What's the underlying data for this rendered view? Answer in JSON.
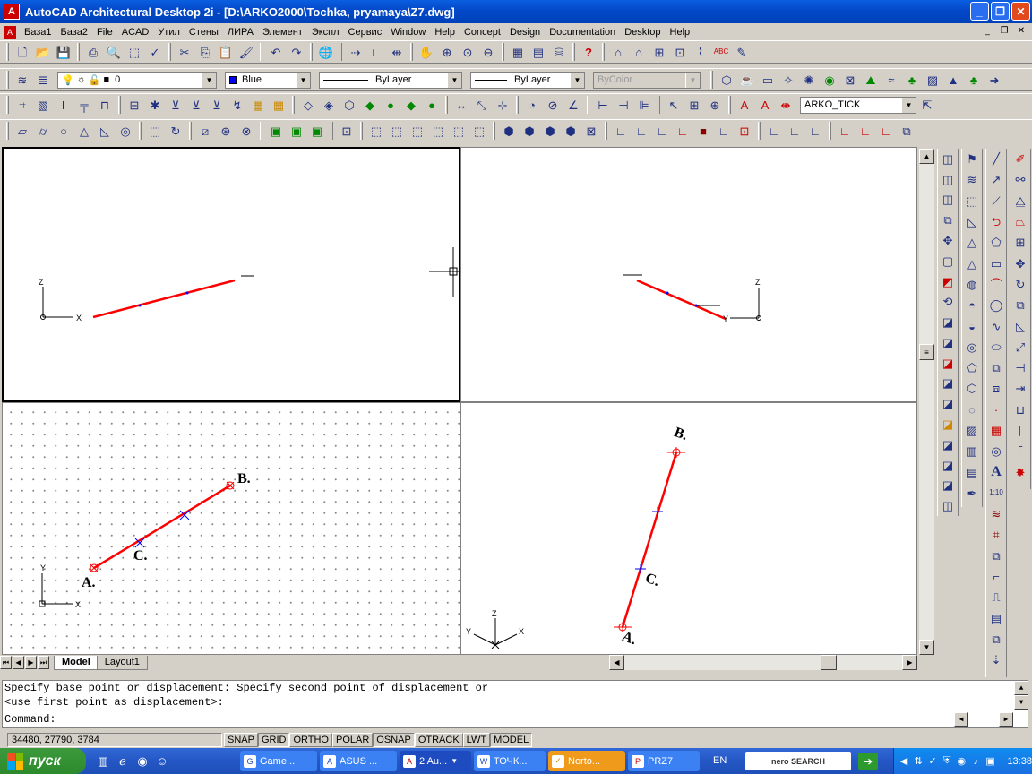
{
  "window": {
    "title": "AutoCAD Architectural Desktop 2i - [D:\\ARKO2000\\Tochka, pryamaya\\Z7.dwg]",
    "app_icon": "autocad-icon",
    "buttons": {
      "minimize": "_",
      "maximize": "❐",
      "close": "✕"
    }
  },
  "menu": {
    "items": [
      "База1",
      "База2",
      "File",
      "ACAD",
      "Утил",
      "Стены",
      "ЛИРА",
      "Элемент",
      "Экспл",
      "Сервис",
      "Window",
      "Help",
      "Concept",
      "Design",
      "Documentation",
      "Desktop",
      "Help"
    ],
    "mdi": {
      "minimize": "_",
      "restore": "❐",
      "close": "✕"
    }
  },
  "layer_toolbar": {
    "layer_value": "0",
    "color_value": "Blue",
    "linetype_value": "ByLayer",
    "lineweight_value": "ByLayer",
    "plotstyle_value": "ByColor",
    "color_swatch": "#0000ff"
  },
  "dim_toolbar": {
    "dimstyle_value": "ARKO_TICK"
  },
  "drawing": {
    "line_color": "#ff0000",
    "marker_color": "#0000ff",
    "labels": {
      "a": "A.",
      "b": "B.",
      "c": "C.",
      "a_iso": "A.",
      "b_iso": "B.",
      "c_iso": "C."
    },
    "ucs": {
      "x": "X",
      "y": "Y",
      "z": "Z"
    }
  },
  "tabs": {
    "model": "Model",
    "layout1": "Layout1"
  },
  "command": {
    "line1": "Specify base point or displacement: Specify second point of displacement or",
    "line2": "<use first point as displacement>:",
    "prompt": "Command:"
  },
  "status": {
    "coords": "34480, 27790, 3784",
    "toggles": [
      {
        "label": "SNAP",
        "on": false
      },
      {
        "label": "GRID",
        "on": true
      },
      {
        "label": "ORTHO",
        "on": false
      },
      {
        "label": "POLAR",
        "on": false
      },
      {
        "label": "OSNAP",
        "on": true
      },
      {
        "label": "OTRACK",
        "on": false
      },
      {
        "label": "LWT",
        "on": false
      },
      {
        "label": "MODEL",
        "on": true
      }
    ]
  },
  "taskbar": {
    "start": "пуск",
    "tasks": [
      {
        "label": "Game...",
        "icon": "game-icon"
      },
      {
        "label": "ASUS ...",
        "icon": "asus-icon"
      },
      {
        "label": "2 Au...",
        "icon": "autocad-icon"
      },
      {
        "label": "ТОЧК...",
        "icon": "word-icon"
      },
      {
        "label": "Norto...",
        "icon": "norton-icon"
      },
      {
        "label": "PRZ7",
        "icon": "pdf-icon"
      }
    ],
    "language": "EN",
    "nero": "nero SEARCH",
    "clock": "13:38"
  }
}
